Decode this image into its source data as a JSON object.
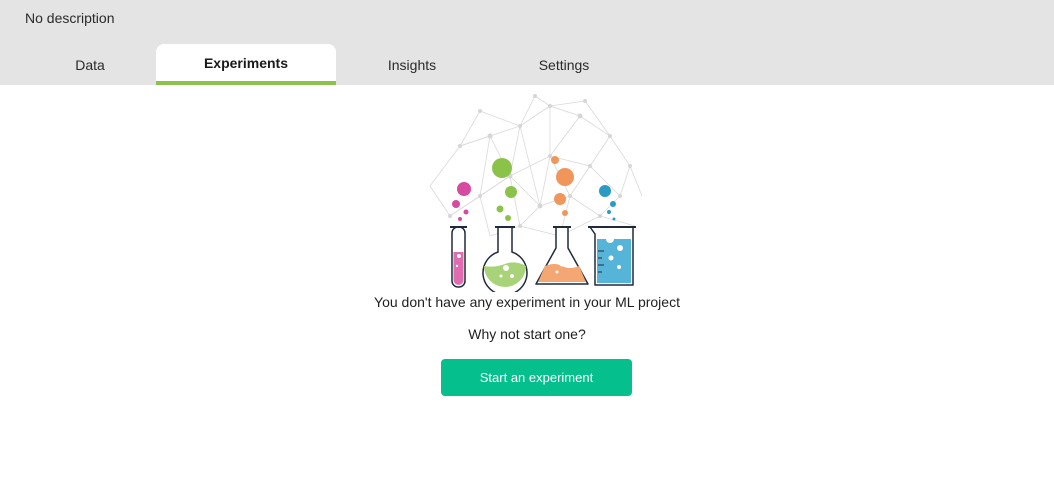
{
  "header": {
    "description": "No description",
    "tabs": [
      {
        "label": "Data",
        "active": false
      },
      {
        "label": "Experiments",
        "active": true
      },
      {
        "label": "Insights",
        "active": false
      },
      {
        "label": "Settings",
        "active": false
      }
    ],
    "active_tab_color": "#8bc34a",
    "background_color": "#e4e4e4"
  },
  "empty_state": {
    "illustration_icon": "lab-flasks-icon",
    "message": "You don't have any experiment in your ML project",
    "prompt": "Why not start one?",
    "button_label": "Start an experiment",
    "button_color": "#05bf8c"
  }
}
